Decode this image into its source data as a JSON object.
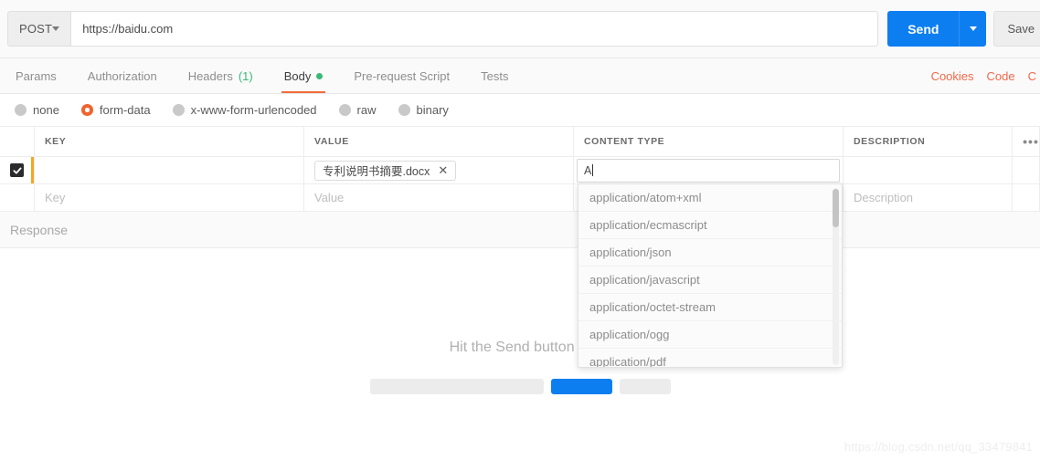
{
  "request": {
    "method": "POST",
    "url": "https://baidu.com",
    "send_label": "Send",
    "save_label": "Save"
  },
  "tabs": [
    {
      "label": "Params",
      "active": false,
      "count": "",
      "dot": false
    },
    {
      "label": "Authorization",
      "active": false,
      "count": "",
      "dot": false
    },
    {
      "label": "Headers",
      "active": false,
      "count": "(1)",
      "dot": false
    },
    {
      "label": "Body",
      "active": true,
      "count": "",
      "dot": true
    },
    {
      "label": "Pre-request Script",
      "active": false,
      "count": "",
      "dot": false
    },
    {
      "label": "Tests",
      "active": false,
      "count": "",
      "dot": false
    }
  ],
  "tab_links": [
    {
      "label": "Cookies"
    },
    {
      "label": "Code"
    },
    {
      "label": "C"
    }
  ],
  "body_types": [
    {
      "label": "none",
      "selected": false
    },
    {
      "label": "form-data",
      "selected": true
    },
    {
      "label": "x-www-form-urlencoded",
      "selected": false
    },
    {
      "label": "raw",
      "selected": false
    },
    {
      "label": "binary",
      "selected": false
    }
  ],
  "table": {
    "columns": [
      "KEY",
      "VALUE",
      "CONTENT TYPE",
      "DESCRIPTION"
    ],
    "menu_icon": "•••",
    "rows": [
      {
        "checked": true,
        "key": "",
        "file_chip": "专利说明书摘要.docx",
        "file_remove": "✕",
        "content_type": "A",
        "description": ""
      }
    ],
    "placeholder_row": {
      "key": "Key",
      "value": "Value",
      "content_type": "",
      "description": "Description"
    }
  },
  "content_type_dropdown": {
    "options": [
      "application/atom+xml",
      "application/ecmascript",
      "application/json",
      "application/javascript",
      "application/octet-stream",
      "application/ogg",
      "application/pdf"
    ]
  },
  "response": {
    "title": "Response",
    "hint": "Hit the Send button to"
  },
  "watermark": "https://blog.csdn.net/qq_33479841",
  "colors": {
    "accent_blue": "#0d7ef0",
    "accent_orange": "#f26b3a",
    "link_orange": "#f0694a",
    "green": "#3cb878",
    "row_accent": "#f5a623"
  }
}
